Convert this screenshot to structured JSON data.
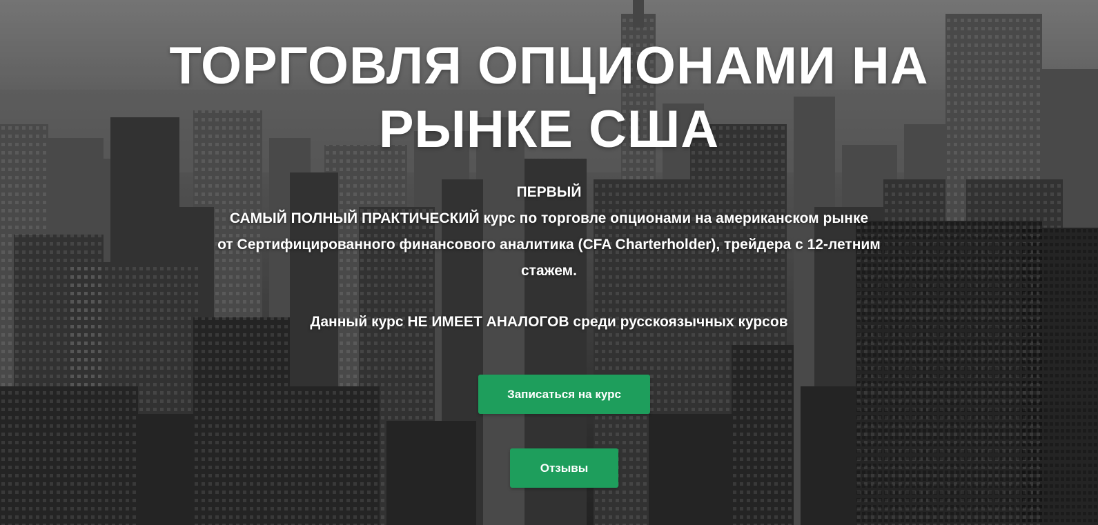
{
  "hero": {
    "title_line1": "ТОРГОВЛЯ ОПЦИОНАМИ НА",
    "title_line2": "РЫНКЕ США",
    "desc_line1": "ПЕРВЫЙ",
    "desc_line2": "САМЫЙ ПОЛНЫЙ ПРАКТИЧЕСКИЙ курс по торговле опционами на американском рынке",
    "desc_line3": "от Сертифицированного финансового аналитика (CFA Charterholder), трейдера с 12-летним",
    "desc_line4": "стажем.",
    "tagline": "Данный курс НЕ ИМЕЕТ АНАЛОГОВ среди русскоязычных курсов",
    "enroll_label": "Записаться на курс",
    "reviews_label": "Отзывы"
  },
  "colors": {
    "button": "#1e9e5c",
    "text": "#ffffff"
  }
}
